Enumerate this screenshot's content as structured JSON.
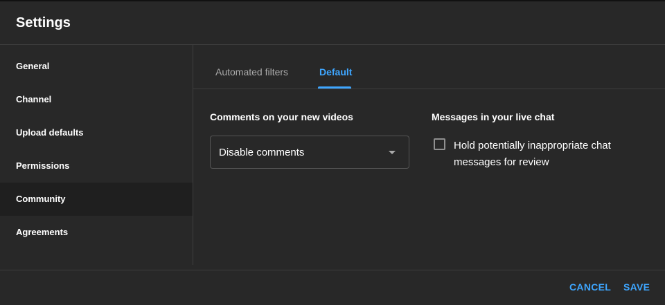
{
  "dialog": {
    "title": "Settings"
  },
  "sidebar": {
    "items": [
      {
        "label": "General"
      },
      {
        "label": "Channel"
      },
      {
        "label": "Upload defaults"
      },
      {
        "label": "Permissions"
      },
      {
        "label": "Community",
        "active": true
      },
      {
        "label": "Agreements"
      }
    ]
  },
  "tabs": [
    {
      "label": "Automated filters"
    },
    {
      "label": "Default",
      "active": true
    }
  ],
  "comments": {
    "label": "Comments on your new videos",
    "selected": "Disable comments"
  },
  "livechat": {
    "label": "Messages in your live chat",
    "checkbox_label": "Hold potentially inappropriate chat messages for review",
    "checked": false
  },
  "footer": {
    "cancel": "CANCEL",
    "save": "SAVE"
  },
  "colors": {
    "accent": "#3ea6ff",
    "background": "#282828",
    "active_nav": "#1f1f1f"
  }
}
